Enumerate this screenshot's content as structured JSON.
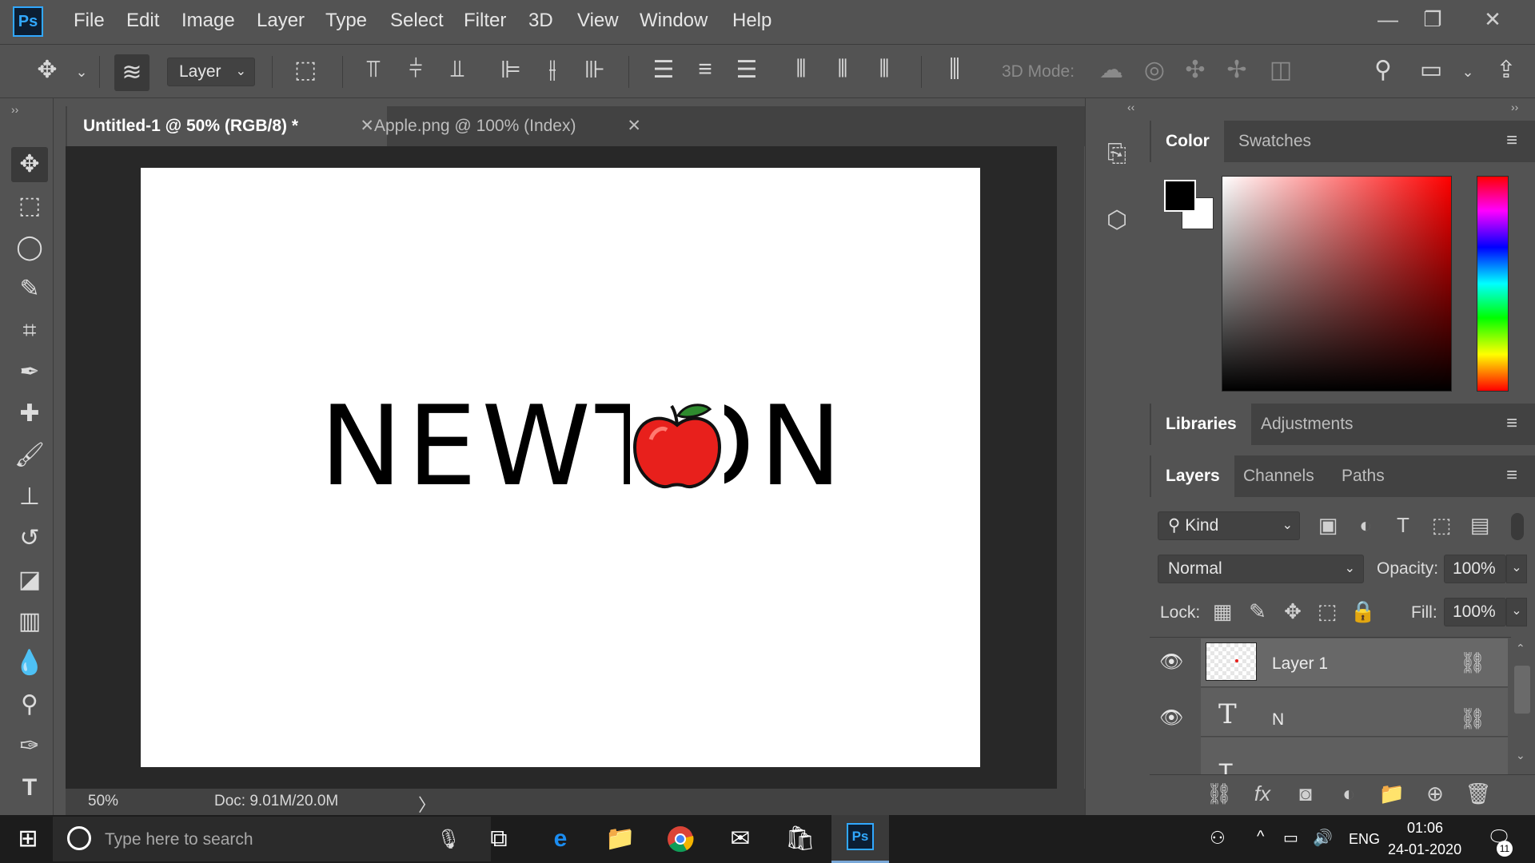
{
  "app": {
    "logo_text": "Ps"
  },
  "menu": [
    "File",
    "Edit",
    "Image",
    "Layer",
    "Type",
    "Select",
    "Filter",
    "3D",
    "View",
    "Window",
    "Help"
  ],
  "options": {
    "layer_select_value": "Layer",
    "threed_mode_label": "3D Mode:"
  },
  "tabs": [
    {
      "label": "Untitled-1 @ 50% (RGB/8) *",
      "active": true
    },
    {
      "label": "Apple.png @ 100% (Index)",
      "active": false
    }
  ],
  "canvas": {
    "text": "NEWTON"
  },
  "status": {
    "zoom": "50%",
    "doc_size": "Doc: 9.01M/20.0M",
    "arrow": "〉"
  },
  "panels": {
    "color_tabs": [
      "Color",
      "Swatches"
    ],
    "lib_tabs": [
      "Libraries",
      "Adjustments"
    ],
    "layer_tabs": [
      "Layers",
      "Channels",
      "Paths"
    ],
    "filter_kind": "Kind",
    "blend_mode": "Normal",
    "opacity_label": "Opacity:",
    "opacity_value": "100%",
    "lock_label": "Lock:",
    "fill_label": "Fill:",
    "fill_value": "100%",
    "layers": [
      {
        "name": "Layer 1",
        "type": "raster"
      },
      {
        "name": "N",
        "type": "text"
      }
    ]
  },
  "taskbar": {
    "search_placeholder": "Type here to search",
    "lang": "ENG",
    "time": "01:06",
    "date": "24-01-2020",
    "notifications": "11"
  },
  "colors": {
    "accent": "#31a8ff",
    "apple_red": "#e8201c",
    "leaf_green": "#2e8b2e"
  }
}
